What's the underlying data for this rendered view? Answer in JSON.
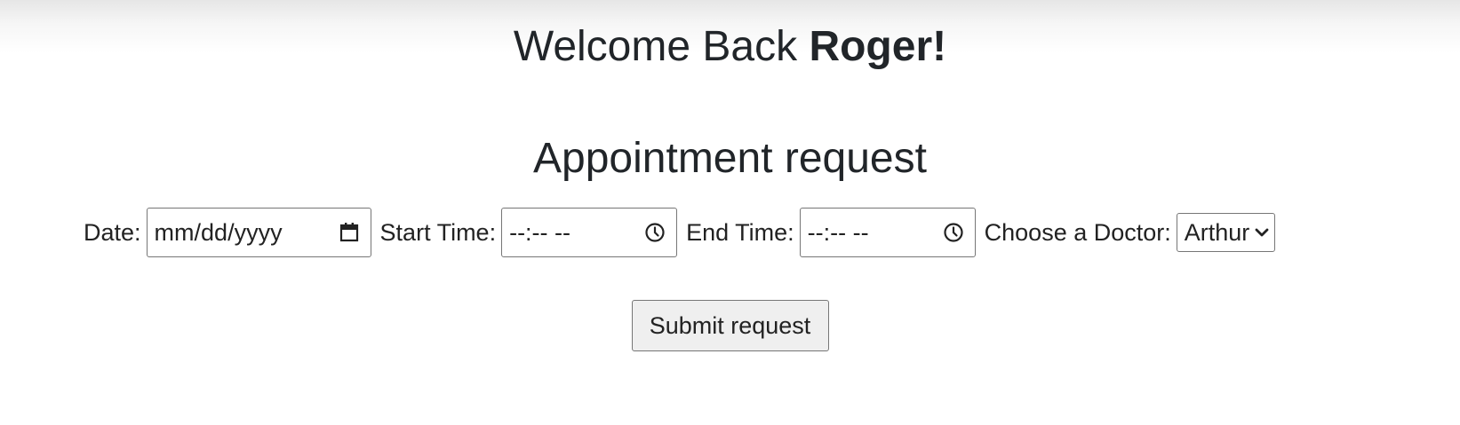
{
  "header": {
    "welcome_prefix": "Welcome Back ",
    "user_name": "Roger!"
  },
  "form": {
    "title": "Appointment request",
    "date_label": "Date:",
    "date_placeholder": "mm/dd/yyyy",
    "start_time_label": "Start Time:",
    "start_time_placeholder": "--:-- --",
    "end_time_label": "End Time:",
    "end_time_placeholder": "--:-- --",
    "doctor_label": "Choose a Doctor:",
    "doctor_selected": "Arthur",
    "submit_label": "Submit request"
  },
  "icons": {
    "date": "calendar-icon",
    "start_time": "clock-icon",
    "end_time": "clock-icon",
    "doctor_select": "chevron-down-icon"
  },
  "colors": {
    "text": "#212529",
    "border": "#767676",
    "button_bg": "#efefef"
  }
}
